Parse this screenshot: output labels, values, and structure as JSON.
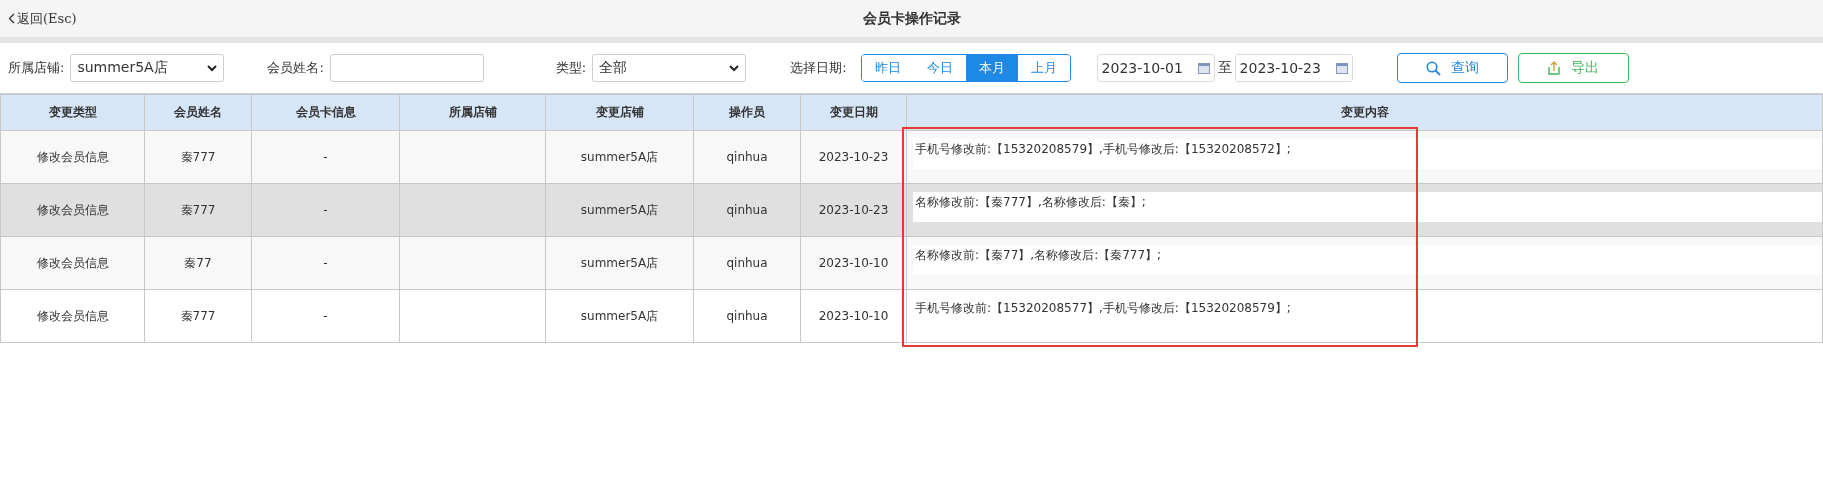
{
  "header": {
    "back": "返回(Esc)",
    "title": "会员卡操作记录"
  },
  "filters": {
    "store_label": "所属店铺:",
    "store_value": "summer5A店",
    "name_label": "会员姓名:",
    "type_label": "类型:",
    "type_value": "全部",
    "date_label": "选择日期:",
    "ranges": [
      {
        "label": "昨日",
        "selected": false
      },
      {
        "label": "今日",
        "selected": false
      },
      {
        "label": "本月",
        "selected": true
      },
      {
        "label": "上月",
        "selected": false
      }
    ],
    "date_from": "2023-10-01",
    "date_sep": "至",
    "date_to": "2023-10-23",
    "search_button": "查询",
    "export_button": "导出"
  },
  "table": {
    "columns": [
      "变更类型",
      "会员姓名",
      "会员卡信息",
      "所属店铺",
      "变更店铺",
      "操作员",
      "变更日期",
      "变更内容"
    ],
    "rows": [
      {
        "selected": false,
        "cells": [
          "修改会员信息",
          "秦777",
          "-",
          "",
          "summer5A店",
          "qinhua",
          "2023-10-23",
          "手机号修改前:【15320208579】,手机号修改后:【15320208572】;"
        ]
      },
      {
        "selected": true,
        "cells": [
          "修改会员信息",
          "秦777",
          "-",
          "",
          "summer5A店",
          "qinhua",
          "2023-10-23",
          "名称修改前:【秦777】,名称修改后:【秦】;"
        ]
      },
      {
        "selected": false,
        "cells": [
          "修改会员信息",
          "秦77",
          "-",
          "",
          "summer5A店",
          "qinhua",
          "2023-10-10",
          "名称修改前:【秦77】,名称修改后:【秦777】;"
        ]
      },
      {
        "selected": false,
        "cells": [
          "修改会员信息",
          "秦777",
          "-",
          "",
          "summer5A店",
          "qinhua",
          "2023-10-10",
          "手机号修改前:【15320208577】,手机号修改后:【15320208579】;"
        ]
      }
    ]
  }
}
